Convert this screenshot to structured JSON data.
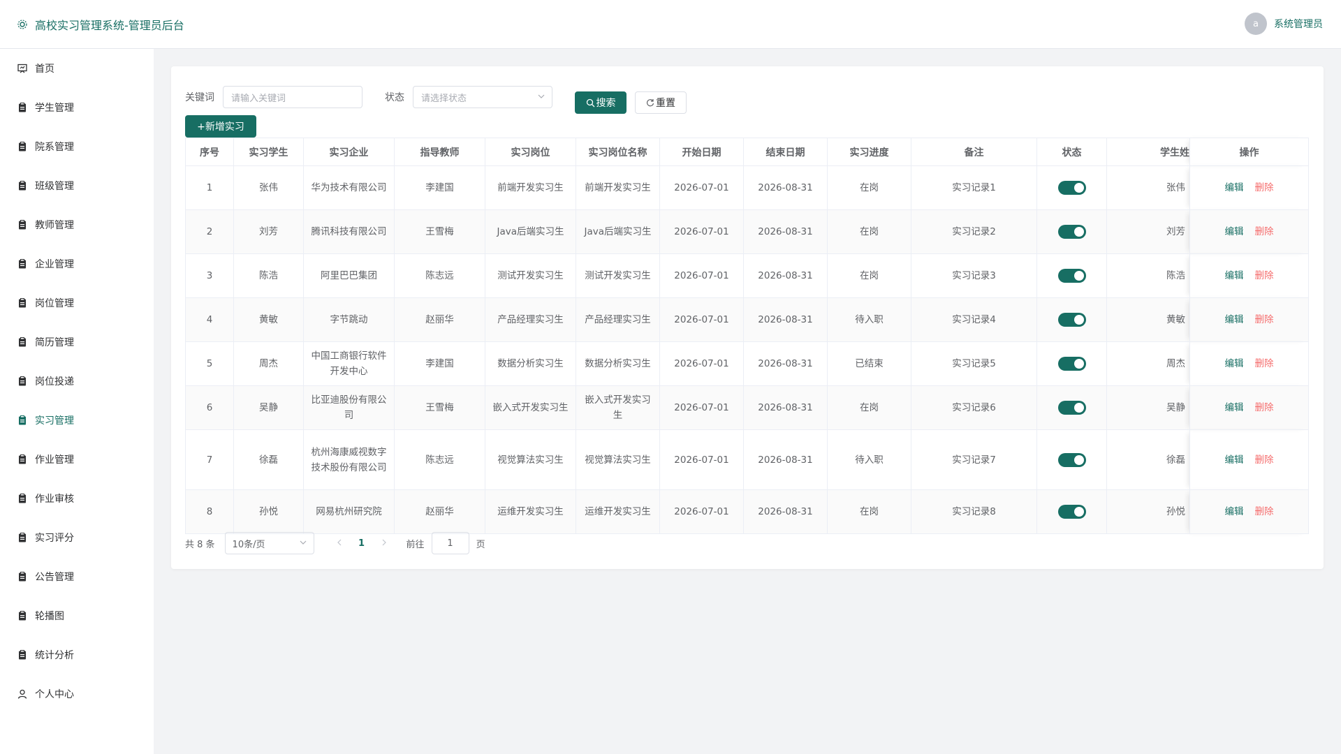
{
  "header": {
    "title": "高校实习管理系统-管理员后台",
    "avatar_letter": "a",
    "username": "系统管理员"
  },
  "sidebar": {
    "items": [
      {
        "label": "首页",
        "icon": "dashboard-icon"
      },
      {
        "label": "学生管理",
        "icon": "clipboard-icon"
      },
      {
        "label": "院系管理",
        "icon": "clipboard-icon"
      },
      {
        "label": "班级管理",
        "icon": "clipboard-icon"
      },
      {
        "label": "教师管理",
        "icon": "clipboard-icon"
      },
      {
        "label": "企业管理",
        "icon": "clipboard-icon"
      },
      {
        "label": "岗位管理",
        "icon": "clipboard-icon"
      },
      {
        "label": "简历管理",
        "icon": "clipboard-icon"
      },
      {
        "label": "岗位投递",
        "icon": "clipboard-icon"
      },
      {
        "label": "实习管理",
        "icon": "clipboard-icon",
        "active": true
      },
      {
        "label": "作业管理",
        "icon": "clipboard-icon"
      },
      {
        "label": "作业审核",
        "icon": "clipboard-icon"
      },
      {
        "label": "实习评分",
        "icon": "clipboard-icon"
      },
      {
        "label": "公告管理",
        "icon": "clipboard-icon"
      },
      {
        "label": "轮播图",
        "icon": "clipboard-icon"
      },
      {
        "label": "统计分析",
        "icon": "clipboard-icon"
      },
      {
        "label": "个人中心",
        "icon": "user-icon"
      }
    ]
  },
  "filter": {
    "keyword_label": "关键词",
    "keyword_placeholder": "请输入关键词",
    "status_label": "状态",
    "status_placeholder": "请选择状态",
    "search_label": "搜索",
    "reset_label": "重置"
  },
  "add_button_label": "+新增实习",
  "table": {
    "columns": [
      "序号",
      "实习学生",
      "实习企业",
      "指导教师",
      "实习岗位",
      "实习岗位名称",
      "开始日期",
      "结束日期",
      "实习进度",
      "备注",
      "状态",
      "学生姓",
      "操作"
    ],
    "edit_label": "编辑",
    "delete_label": "删除",
    "rows": [
      {
        "no": "1",
        "student": "张伟",
        "company": "华为技术有限公司",
        "teacher": "李建国",
        "position": "前端开发实习生",
        "position_name": "前端开发实习生",
        "start": "2026-07-01",
        "end": "2026-08-31",
        "progress": "在岗",
        "remark": "实习记录1",
        "status_on": true,
        "student_name": "张伟"
      },
      {
        "no": "2",
        "student": "刘芳",
        "company": "腾讯科技有限公司",
        "teacher": "王雪梅",
        "position": "Java后端实习生",
        "position_name": "Java后端实习生",
        "start": "2026-07-01",
        "end": "2026-08-31",
        "progress": "在岗",
        "remark": "实习记录2",
        "status_on": true,
        "student_name": "刘芳"
      },
      {
        "no": "3",
        "student": "陈浩",
        "company": "阿里巴巴集团",
        "teacher": "陈志远",
        "position": "测试开发实习生",
        "position_name": "测试开发实习生",
        "start": "2026-07-01",
        "end": "2026-08-31",
        "progress": "在岗",
        "remark": "实习记录3",
        "status_on": true,
        "student_name": "陈浩"
      },
      {
        "no": "4",
        "student": "黄敏",
        "company": "字节跳动",
        "teacher": "赵丽华",
        "position": "产品经理实习生",
        "position_name": "产品经理实习生",
        "start": "2026-07-01",
        "end": "2026-08-31",
        "progress": "待入职",
        "remark": "实习记录4",
        "status_on": true,
        "student_name": "黄敏"
      },
      {
        "no": "5",
        "student": "周杰",
        "company": "中国工商银行软件开发中心",
        "teacher": "李建国",
        "position": "数据分析实习生",
        "position_name": "数据分析实习生",
        "start": "2026-07-01",
        "end": "2026-08-31",
        "progress": "已结束",
        "remark": "实习记录5",
        "status_on": true,
        "student_name": "周杰"
      },
      {
        "no": "6",
        "student": "吴静",
        "company": "比亚迪股份有限公司",
        "teacher": "王雪梅",
        "position": "嵌入式开发实习生",
        "position_name": "嵌入式开发实习生",
        "start": "2026-07-01",
        "end": "2026-08-31",
        "progress": "在岗",
        "remark": "实习记录6",
        "status_on": true,
        "student_name": "吴静"
      },
      {
        "no": "7",
        "student": "徐磊",
        "company": "杭州海康威视数字技术股份有限公司",
        "teacher": "陈志远",
        "position": "视觉算法实习生",
        "position_name": "视觉算法实习生",
        "start": "2026-07-01",
        "end": "2026-08-31",
        "progress": "待入职",
        "remark": "实习记录7",
        "status_on": true,
        "student_name": "徐磊"
      },
      {
        "no": "8",
        "student": "孙悦",
        "company": "网易杭州研究院",
        "teacher": "赵丽华",
        "position": "运维开发实习生",
        "position_name": "运维开发实习生",
        "start": "2026-07-01",
        "end": "2026-08-31",
        "progress": "在岗",
        "remark": "实习记录8",
        "status_on": true,
        "student_name": "孙悦"
      }
    ]
  },
  "pagination": {
    "total_text": "共 8 条",
    "page_size": "10条/页",
    "current_page": "1",
    "goto_label": "前往",
    "goto_value": "1",
    "page_suffix": "页"
  },
  "colors": {
    "primary": "#176e63",
    "danger": "#f56c6c"
  }
}
